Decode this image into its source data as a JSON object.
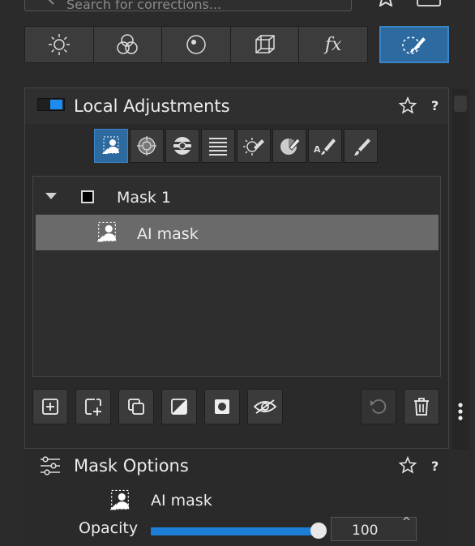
{
  "search": {
    "placeholder": "Search for corrections..."
  },
  "tabs": [
    {
      "icon": "light-icon"
    },
    {
      "icon": "color-icon"
    },
    {
      "icon": "detail-icon"
    },
    {
      "icon": "geometry-icon"
    },
    {
      "icon": "effects-icon",
      "label": "fx"
    },
    {
      "icon": "local-adjustments-icon",
      "active": true
    }
  ],
  "local_adjustments": {
    "title": "Local Adjustments",
    "help": "?",
    "enabled": true,
    "tools": [
      "ai-mask-tool-icon",
      "radial-gradient-tool-icon",
      "circular-gradient-tool-icon",
      "linear-gradient-tool-icon",
      "luminance-range-tool-icon",
      "color-range-tool-icon",
      "auto-brush-icon",
      "brush-icon"
    ],
    "selected_tool": 0,
    "masks": [
      {
        "name": "Mask 1",
        "expanded": true,
        "swatch_color": "#000000"
      }
    ],
    "mask_components": [
      {
        "name": "AI mask",
        "selected": true
      }
    ]
  },
  "mask_options": {
    "title": "Mask Options",
    "help": "?",
    "current_mask": "AI mask",
    "opacity_label": "Opacity",
    "opacity_value": "100",
    "opacity_fraction": 0.97
  },
  "colors": {
    "accent": "#2c6aa0",
    "slider": "#1d7ed8",
    "panel": "#2a2a2a"
  }
}
